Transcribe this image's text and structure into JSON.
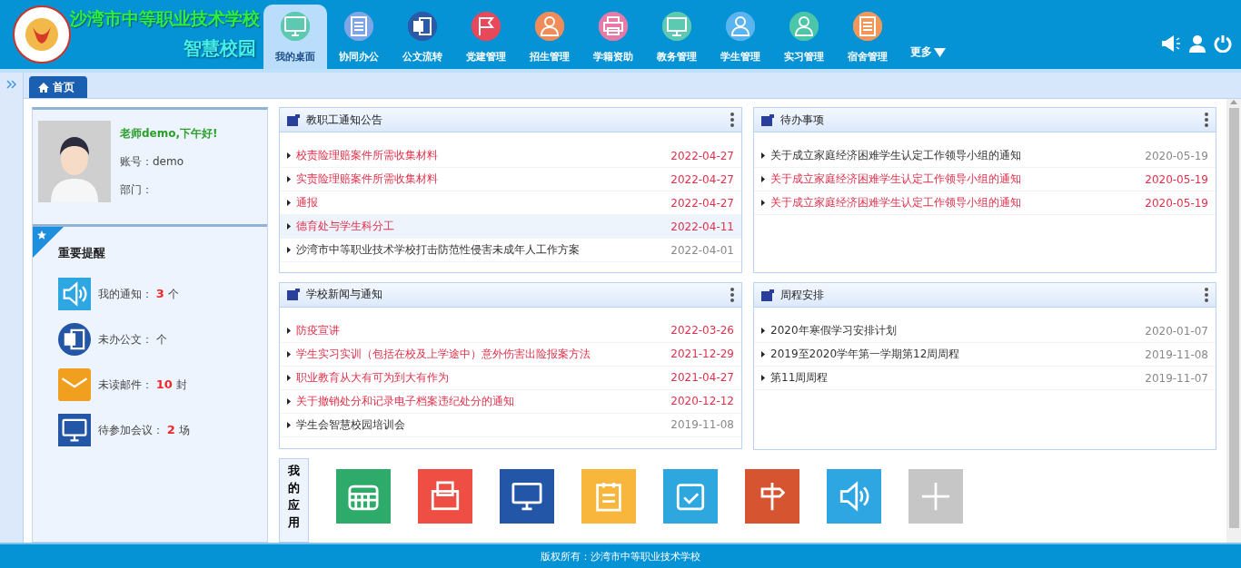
{
  "header": {
    "school_name": "沙湾市中等职业技术学校",
    "system_name": "智慧校园",
    "nav": [
      {
        "label": "我的桌面",
        "selected": true,
        "color": "#5cc9b0"
      },
      {
        "label": "协同办公",
        "selected": false,
        "color": "#7ea6e6"
      },
      {
        "label": "公文流转",
        "selected": false,
        "color": "#2b5aa8"
      },
      {
        "label": "党建管理",
        "selected": false,
        "color": "#e8485a"
      },
      {
        "label": "招生管理",
        "selected": false,
        "color": "#f08c5a"
      },
      {
        "label": "学籍资助",
        "selected": false,
        "color": "#e87aa8"
      },
      {
        "label": "教务管理",
        "selected": false,
        "color": "#5cc9b0"
      },
      {
        "label": "学生管理",
        "selected": false,
        "color": "#5ab4ee"
      },
      {
        "label": "实习管理",
        "selected": false,
        "color": "#4cc6a8"
      },
      {
        "label": "宿舍管理",
        "selected": false,
        "color": "#f0985a"
      }
    ],
    "more": "更多"
  },
  "tabs": [
    {
      "label": "首页",
      "selected": true
    }
  ],
  "profile": {
    "greeting": "老师demo,下午好!",
    "account": "账号：demo",
    "department": "部门："
  },
  "reminders": {
    "title": "重要提醒",
    "items": [
      {
        "kind": "speaker",
        "label": "我的通知：",
        "count": "3",
        "unit": "个"
      },
      {
        "kind": "word",
        "label": "未办公文：",
        "unit": "个"
      },
      {
        "kind": "mail",
        "label": "未读邮件：",
        "count": "10",
        "unit": "封"
      },
      {
        "kind": "monitor",
        "label": "待参加会议：",
        "count": "2",
        "unit": "场"
      }
    ]
  },
  "panels": [
    {
      "title": "教职工通知公告",
      "items": [
        {
          "text": "校责险理赔案件所需收集材料",
          "date": "2022-04-27",
          "highlighted": true,
          "hovered": false
        },
        {
          "text": "实责险理赔案件所需收集材料",
          "date": "2022-04-27",
          "highlighted": true,
          "hovered": false
        },
        {
          "text": "通报",
          "date": "2022-04-27",
          "highlighted": true,
          "hovered": false
        },
        {
          "text": "德育处与学生科分工",
          "date": "2022-04-11",
          "highlighted": true,
          "hovered": true
        },
        {
          "text": "沙湾市中等职业技术学校打击防范性侵害未成年人工作方案",
          "date": "2022-04-01",
          "highlighted": false,
          "hovered": false
        }
      ]
    },
    {
      "title": "待办事项",
      "items": [
        {
          "text": "关于成立家庭经济困难学生认定工作领导小组的通知",
          "date": "2020-05-19",
          "highlighted": false,
          "hovered": false
        },
        {
          "text": "关于成立家庭经济困难学生认定工作领导小组的通知",
          "date": "2020-05-19",
          "highlighted": true,
          "hovered": false
        },
        {
          "text": "关于成立家庭经济困难学生认定工作领导小组的通知",
          "date": "2020-05-19",
          "highlighted": true,
          "hovered": false
        }
      ]
    },
    {
      "title": "学校新闻与通知",
      "items": [
        {
          "text": "防疫宣讲",
          "date": "2022-03-26",
          "highlighted": true,
          "hovered": false
        },
        {
          "text": "学生实习实训（包括在校及上学途中）意外伤害出险报案方法",
          "date": "2021-12-29",
          "highlighted": true,
          "hovered": false
        },
        {
          "text": "职业教育从大有可为到大有作为",
          "date": "2021-04-27",
          "highlighted": true,
          "hovered": false
        },
        {
          "text": "关于撤销处分和记录电子档案违纪处分的通知",
          "date": "2020-12-12",
          "highlighted": true,
          "hovered": false
        },
        {
          "text": "学生会智慧校园培训会",
          "date": "2019-11-08",
          "highlighted": false,
          "hovered": false
        }
      ]
    },
    {
      "title": "周程安排",
      "items": [
        {
          "text": "2020年寒假学习安排计划",
          "date": "2020-01-07",
          "highlighted": false,
          "hovered": false
        },
        {
          "text": "2019至2020学年第一学期第12周周程",
          "date": "2019-11-08",
          "highlighted": false,
          "hovered": false
        },
        {
          "text": "第11周周程",
          "date": "2019-11-07",
          "highlighted": false,
          "hovered": false
        }
      ]
    }
  ],
  "apps": {
    "title": "我的应用",
    "tiles": [
      {
        "kind": "calendar",
        "color": "#2eaa6a"
      },
      {
        "kind": "wallet",
        "color": "#ee4e44"
      },
      {
        "kind": "monitor",
        "color": "#2356a6"
      },
      {
        "kind": "clipboard",
        "color": "#f8b73c"
      },
      {
        "kind": "check",
        "color": "#2ea6de"
      },
      {
        "kind": "signpost",
        "color": "#d65430"
      },
      {
        "kind": "speaker",
        "color": "#2ea6e2"
      },
      {
        "kind": "plus",
        "color": "#c6c6c6"
      }
    ]
  },
  "footer": "版权所有：沙湾市中等职业技术学校"
}
